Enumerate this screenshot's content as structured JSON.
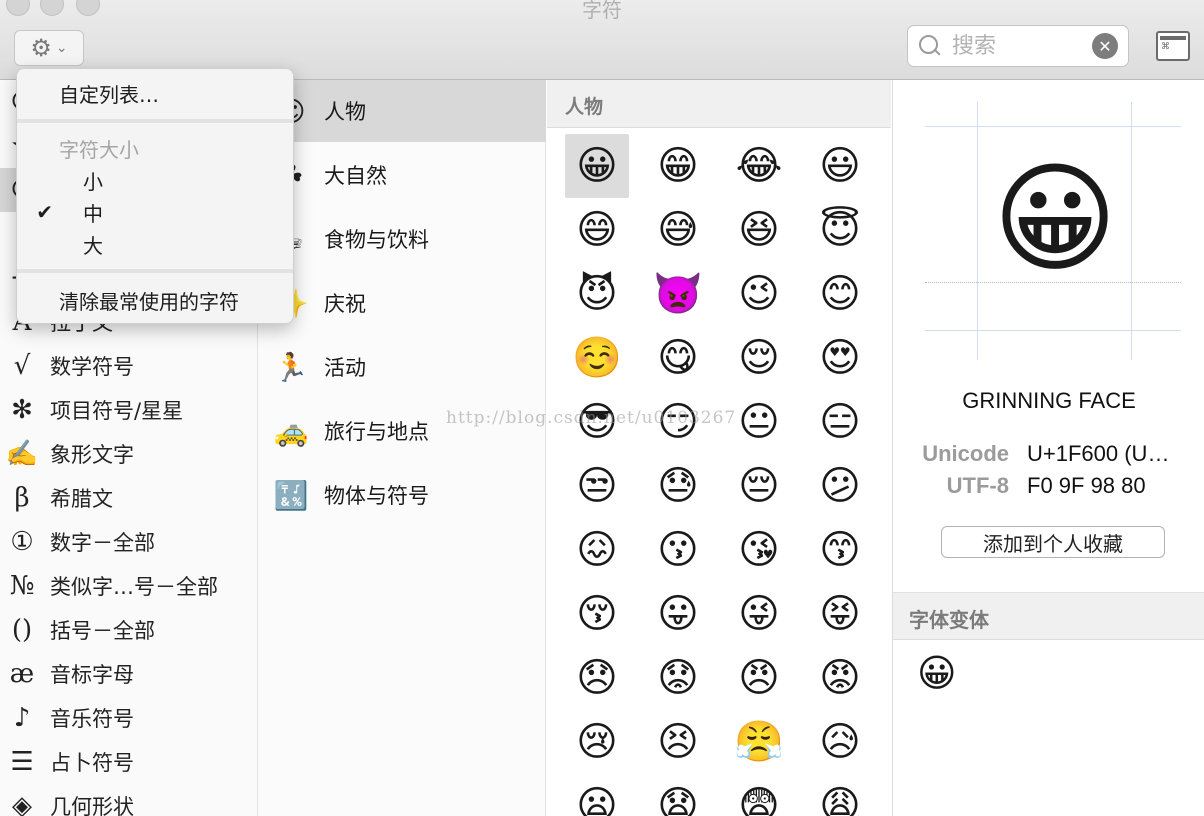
{
  "window": {
    "title": "字符"
  },
  "toolbar": {
    "gear_chevron": "⌄",
    "search_placeholder": "搜索",
    "keyboard_label": "⌘"
  },
  "gear_menu": {
    "customize": "自定列表…",
    "size_header": "字符大小",
    "sizes": [
      {
        "label": "小",
        "checked": false
      },
      {
        "label": "中",
        "checked": true
      },
      {
        "label": "大",
        "checked": false
      }
    ],
    "clear_recent": "清除最常使用的字符"
  },
  "sidebar": {
    "items": [
      {
        "icon": "☺",
        "label": "",
        "icon_name": "smiley-icon"
      },
      {
        "icon": "★",
        "label": "",
        "icon_name": "star-icon"
      },
      {
        "icon": "☺",
        "label": "",
        "icon_name": "emoji-icon"
      },
      {
        "icon": "$",
        "label": "",
        "icon_name": "currency-icon"
      },
      {
        "icon": "→",
        "label": "",
        "icon_name": "arrow-icon"
      },
      {
        "icon": "A",
        "label": "拉丁文",
        "icon_name": "latin-icon"
      },
      {
        "icon": "√",
        "label": "数学符号",
        "icon_name": "math-icon"
      },
      {
        "icon": "✻",
        "label": "项目符号/星星",
        "icon_name": "bullet-icon"
      },
      {
        "icon": "✍",
        "label": "象形文字",
        "icon_name": "pictograph-icon"
      },
      {
        "icon": "β",
        "label": "希腊文",
        "icon_name": "greek-icon"
      },
      {
        "icon": "①",
        "label": "数字－全部",
        "icon_name": "digits-icon"
      },
      {
        "icon": "№",
        "label": "类似字…号－全部",
        "icon_name": "letterlike-icon"
      },
      {
        "icon": "()",
        "label": "括号－全部",
        "icon_name": "parentheses-icon"
      },
      {
        "icon": "æ",
        "label": "音标字母",
        "icon_name": "phonetic-icon"
      },
      {
        "icon": "♪",
        "label": "音乐符号",
        "icon_name": "music-icon"
      },
      {
        "icon": "☰",
        "label": "占卜符号",
        "icon_name": "divination-icon"
      },
      {
        "icon": "◈",
        "label": "几何形状",
        "icon_name": "geometric-icon"
      }
    ]
  },
  "categories": {
    "items": [
      {
        "icon": "☺",
        "label": "人物",
        "selected": true,
        "icon_name": "people-icon"
      },
      {
        "icon": "☘",
        "label": "大自然",
        "selected": false,
        "icon_name": "nature-icon"
      },
      {
        "icon": "☕",
        "label": "食物与饮料",
        "selected": false,
        "icon_name": "food-icon"
      },
      {
        "icon": "✨",
        "label": "庆祝",
        "selected": false,
        "icon_name": "celebration-icon"
      },
      {
        "icon": "🏃",
        "label": "活动",
        "selected": false,
        "icon_name": "activity-icon"
      },
      {
        "icon": "🚕",
        "label": "旅行与地点",
        "selected": false,
        "icon_name": "travel-icon"
      },
      {
        "icon": "🔣",
        "label": "物体与符号",
        "selected": false,
        "icon_name": "symbols-icon"
      }
    ]
  },
  "grid": {
    "header": "人物",
    "emojis": [
      "😀",
      "😁",
      "😂",
      "😃",
      "😄",
      "😅",
      "😆",
      "😇",
      "😈",
      "👿",
      "😉",
      "😊",
      "☺️",
      "😋",
      "😌",
      "😍",
      "😎",
      "😏",
      "😐",
      "😑",
      "😒",
      "😓",
      "😔",
      "😕",
      "😖",
      "😗",
      "😘",
      "😙",
      "😚",
      "😛",
      "😜",
      "😝",
      "😞",
      "😟",
      "😠",
      "😡",
      "😢",
      "😣",
      "😤",
      "😥",
      "😦",
      "😧",
      "😨",
      "😩"
    ],
    "selected_index": 0
  },
  "detail": {
    "emoji": "😀",
    "name": "GRINNING FACE",
    "unicode_label": "Unicode",
    "unicode_value": "U+1F600 (U…",
    "utf8_label": "UTF-8",
    "utf8_value": "F0 9F 98 80",
    "favorite_button": "添加到个人收藏",
    "variants_header": "字体变体",
    "variants": [
      "😀"
    ]
  },
  "watermark": "http://blog.csdn.net/u0103267"
}
